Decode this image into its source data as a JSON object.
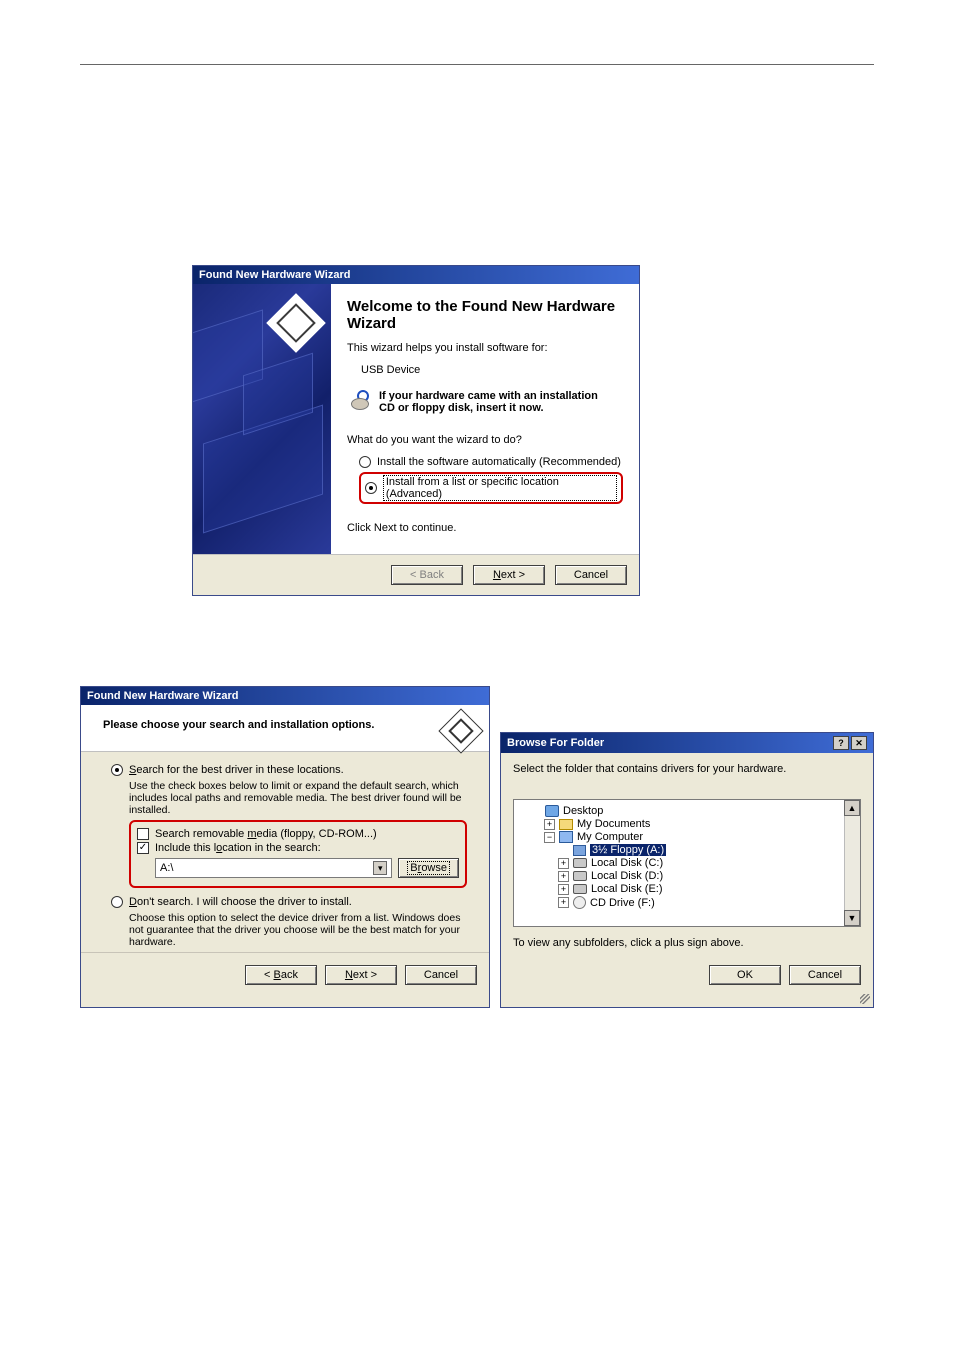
{
  "dialog1": {
    "title": "Found New Hardware Wizard",
    "heading": "Welcome to the Found New Hardware Wizard",
    "intro": "This wizard helps you install software for:",
    "device": "USB Device",
    "cd_note": "If your hardware came with an installation CD or floppy disk, insert it now.",
    "question": "What do you want the wizard to do?",
    "option_auto": "Install the software automatically (Recommended)",
    "option_list": "Install from a list or specific location (Advanced)",
    "continue_note": "Click Next to continue.",
    "buttons": {
      "back": "< Back",
      "next": "Next >",
      "cancel": "Cancel"
    }
  },
  "dialog2": {
    "title": "Found New Hardware Wizard",
    "heading": "Please choose your search and installation options.",
    "opt_search": "Search for the best driver in these locations.",
    "opt_search_desc": "Use the check boxes below to limit or expand the default search, which includes local paths and removable media. The best driver found will be installed.",
    "chk_removable": "Search removable media (floppy, CD-ROM...)",
    "chk_location": "Include this location in the search:",
    "path_value": "A:\\",
    "browse": "Browse",
    "opt_dont": "Don't search. I will choose the driver to install.",
    "opt_dont_desc": "Choose this option to select the device driver from a list. Windows does not guarantee that the driver you choose will be the best match for your hardware.",
    "buttons": {
      "back": "< Back",
      "next": "Next >",
      "cancel": "Cancel"
    }
  },
  "dialog3": {
    "title": "Browse For Folder",
    "msg": "Select the folder that contains drivers for your hardware.",
    "tree": {
      "desktop": "Desktop",
      "mydocs": "My Documents",
      "mycomp": "My Computer",
      "floppy": "3½ Floppy (A:)",
      "c": "Local Disk (C:)",
      "d": "Local Disk (D:)",
      "e": "Local Disk (E:)",
      "f": "CD Drive (F:)"
    },
    "hint": "To view any subfolders, click a plus sign above.",
    "buttons": {
      "ok": "OK",
      "cancel": "Cancel"
    }
  }
}
